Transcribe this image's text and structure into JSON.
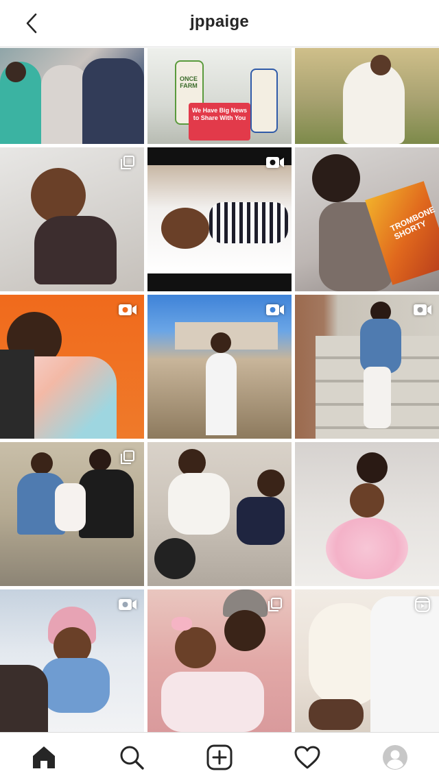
{
  "header": {
    "username": "jppaige",
    "back_icon": "chevron-left-icon"
  },
  "colors": {
    "text": "#262626",
    "divider": "#dbdbdb",
    "background": "#ffffff"
  },
  "posts": [
    {
      "name": "post-1-family-in-masks",
      "type": "photo"
    },
    {
      "name": "post-2-once-upon-a-farm",
      "type": "photo",
      "text": "ONCE FARM",
      "text2": "We Have Big News to Share With You"
    },
    {
      "name": "post-3-mother-and-baby-field",
      "type": "photo"
    },
    {
      "name": "post-4-girl-with-fairy-lights",
      "type": "carousel"
    },
    {
      "name": "post-5-girl-striped-shirt",
      "type": "video"
    },
    {
      "name": "post-6-mother-reading-book",
      "type": "photo",
      "text": "TROMBONE SHORTY"
    },
    {
      "name": "post-7-girl-orange-wall",
      "type": "video"
    },
    {
      "name": "post-8-boy-in-field",
      "type": "video"
    },
    {
      "name": "post-9-mother-daughter-steps",
      "type": "video"
    },
    {
      "name": "post-10-family-sitting",
      "type": "carousel"
    },
    {
      "name": "post-11-mother-son-couch",
      "type": "photo"
    },
    {
      "name": "post-12-mother-daughter-tutu",
      "type": "photo"
    },
    {
      "name": "post-13-girl-pink-beanie",
      "type": "video"
    },
    {
      "name": "post-14-father-daughter",
      "type": "carousel"
    },
    {
      "name": "post-15-father-holding-baby",
      "type": "reel"
    }
  ],
  "tabbar": {
    "items": [
      {
        "name": "home-tab",
        "icon": "home-icon",
        "active": true
      },
      {
        "name": "search-tab",
        "icon": "search-icon",
        "active": false
      },
      {
        "name": "new-post-tab",
        "icon": "plus-square-icon",
        "active": false
      },
      {
        "name": "activity-tab",
        "icon": "heart-icon",
        "active": false
      },
      {
        "name": "profile-tab",
        "icon": "avatar-icon",
        "active": false
      }
    ]
  }
}
